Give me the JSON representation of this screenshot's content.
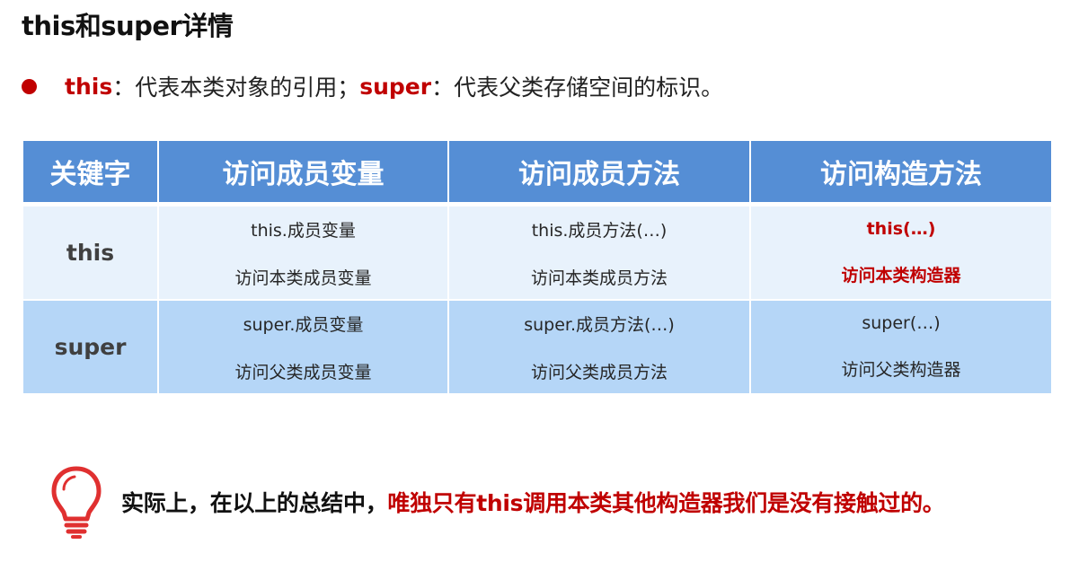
{
  "title": "this和super详情",
  "bullet": {
    "kw1": "this",
    "text1": "：代表本类对象的引用；",
    "kw2": "super",
    "text2": "：代表父类存储空间的标识。"
  },
  "table": {
    "headers": [
      "关键字",
      "访问成员变量",
      "访问成员方法",
      "访问构造方法"
    ],
    "rows": [
      {
        "keyword": "this",
        "var_code": "this.成员变量",
        "var_desc": "访问本类成员变量",
        "method_code": "this.成员方法(…)",
        "method_desc": "访问本类成员方法",
        "ctor_code": "this(…)",
        "ctor_desc": "访问本类构造器"
      },
      {
        "keyword": "super",
        "var_code": "super.成员变量",
        "var_desc": "访问父类成员变量",
        "method_code": "super.成员方法(…)",
        "method_desc": "访问父类成员方法",
        "ctor_code": "super(…)",
        "ctor_desc": "访问父类构造器"
      }
    ]
  },
  "note": {
    "icon": "lightbulb-icon",
    "text_black": "实际上，在以上的总结中，",
    "text_red": "唯独只有this调用本类其他构造器我们是没有接触过的。"
  },
  "colors": {
    "accent_red": "#c00000",
    "header_blue": "#558ed5",
    "row_light": "#e8f2fc",
    "row_dark": "#b5d6f7"
  }
}
